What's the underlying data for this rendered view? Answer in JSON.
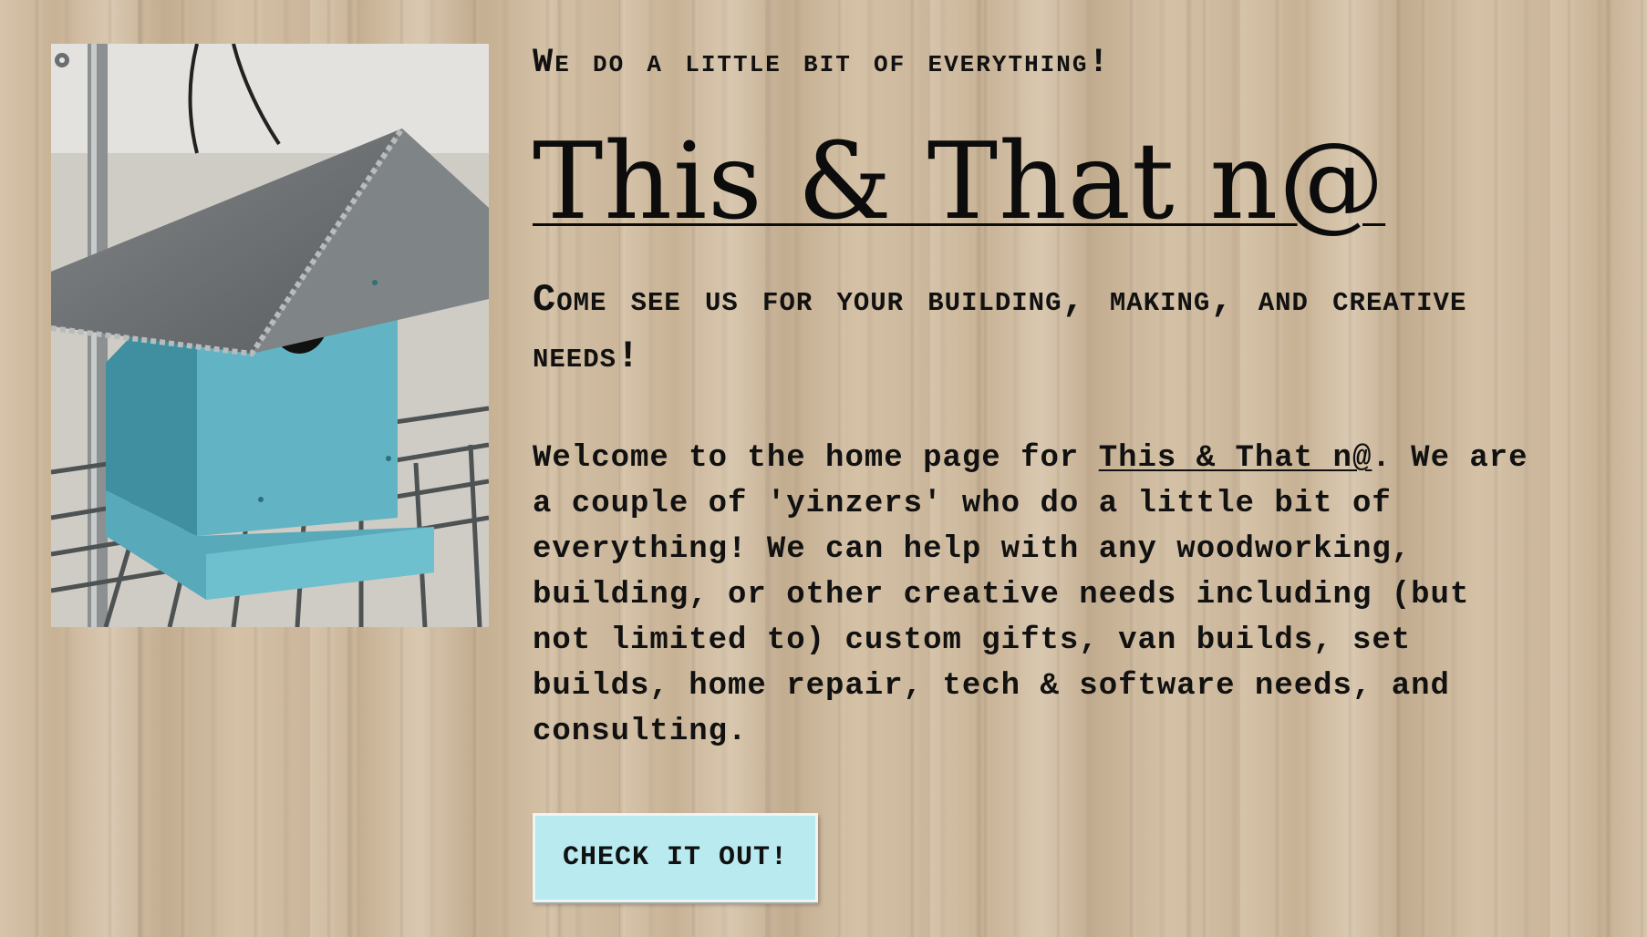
{
  "hero": {
    "tagline": "We do a little bit of everything!",
    "title": "This & That n@",
    "subtitle": "Come see us for your building, making, and creative needs!"
  },
  "intro": {
    "text_before_link": "Welcome to the home page for ",
    "link_text": "This & That n@",
    "text_after_link": ". We are a couple of 'yinzers' who do a little bit of everything! We can help with any woodworking, building, or other creative needs including (but not limited to) custom gifts, van builds, set builds, home repair, tech & software needs, and consulting."
  },
  "cta": {
    "label": "CHECK IT OUT!"
  },
  "photo": {
    "subject": "turquoise-birdhouse-with-metal-roof"
  },
  "colors": {
    "background": "#cbb79d",
    "button": "#b9eaf0",
    "birdhouse": "#5fb6c6",
    "text": "#111111"
  }
}
